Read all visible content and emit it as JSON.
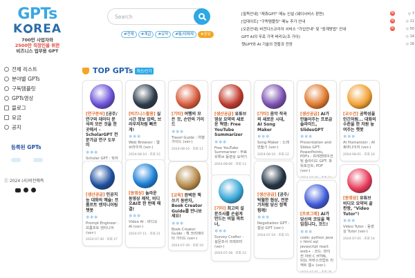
{
  "logo": {
    "line1": "GPTs",
    "line2_a": "K",
    "line2_b": "REA"
  },
  "tagline": {
    "line1": "700만 사업자와",
    "line2": "2500만 직장인을 위한",
    "line3": "비즈니스 업무용 GPT"
  },
  "nav": [
    {
      "label": "전체 리스트",
      "icon": "globe-icon"
    },
    {
      "label": "분야별 GPTs",
      "icon": "globe-icon"
    },
    {
      "label": "구독템플릿",
      "icon": "globe-icon"
    },
    {
      "label": "GPTs영상",
      "icon": "globe-icon"
    },
    {
      "label": "블로그",
      "icon": "doc-icon"
    },
    {
      "label": "요금",
      "icon": "doc-icon"
    },
    {
      "label": "공지",
      "icon": "globe-icon"
    }
  ],
  "side_heading": "등록된 GPTs",
  "copyright": "ⓒ 2024 (사)비전예측",
  "search": {
    "placeholder": "Search"
  },
  "tags": [
    {
      "label": "#전체",
      "accent": false
    },
    {
      "label": "#계급",
      "accent": false
    },
    {
      "label": "#요약",
      "accent": false
    },
    {
      "label": "#통/대체체",
      "accent": false
    },
    {
      "label": "#공유",
      "accent": true
    }
  ],
  "notices": [
    {
      "text": "[필독안내] \"제휴GPT\" 메뉴 신설 (웨이서비스 판면)",
      "badge": "N",
      "count": "7"
    },
    {
      "text": "[업데이트] \"구독템플릿\" 메뉴 추가 안내",
      "badge": "N",
      "count": "11"
    },
    {
      "text": "[오픈안내] 비전다스코리아 서비스 \"가입안내\" 및 \"중계방법\" 안내",
      "badge": "N",
      "count": "50"
    },
    {
      "text": "GPT AI의 무료 가격 버리오(조 가이)",
      "badge": "",
      "count": "14"
    },
    {
      "text": "챗GPT와 AI 기술의 현황과 전망",
      "badge": "",
      "count": "16"
    }
  ],
  "section": {
    "title": "TOP GPTs",
    "badge": "최신/인기"
  },
  "cards": [
    {
      "cat": "[연구분석]",
      "title": " [공주/ 연구와 데이터 분석의 모든 것을 한 곳에서 – ScholarGPT 전문가급 연구 도우미",
      "stars": "❄❄❄",
      "desc": "Scholar GPT : 학자 GPT (ver-)",
      "meta": "1월전 · 조회 7",
      "thumb_color": "#6a4fd8"
    },
    {
      "cat": "[비즈니스활용]",
      "title": " 실시간 정보 입력, 브라우저처럼 빠르게!",
      "stars": "❄❄❄",
      "desc": "Web Browser : 웹 브라우저 (ver-)",
      "meta": "2024-08-10 · 조회 15",
      "thumb_color": "#2b3a4a"
    },
    {
      "cat": "[기타]",
      "title": " 여행의 모든 것, 손안의 가이드",
      "stars": "❄❄❄",
      "desc": "Travel Guide : 여행 가이드 (ver-)",
      "meta": "2024-08-10 · 조회 11",
      "thumb_color": "#d85a3a"
    },
    {
      "cat": "[생산공급]",
      "title": " 유튜브 영상 요약의 새로운 혁명: Free YouTube Summarizer",
      "stars": "❄❄❄",
      "desc": "Free YouTube Summarizer : 무료 유튜브 동영상 요약기",
      "meta": "2024-08-06 · 조회 13",
      "thumb_color": "#c0392b"
    },
    {
      "cat": "[기타]",
      "title": " 음악 작곡의 새로운 시대, AI Song Maker",
      "stars": "❄❄❄",
      "desc": "Song Maker : 노래 만들기 (ver-)",
      "meta": "2024-08-10 · 조회 12",
      "thumb_color": "#7a4fb0"
    },
    {
      "cat": "[생산공급]",
      "title": " AI가 만들어주는 프로급 슬라이드, SlidesGPT",
      "stars": "❄❄❄",
      "desc": "Presentation and Slides GPT: PowerPoints, PDFs : 프레젠테이션 및 슬라이드 GPT: 파워포인트, PDF (ver-)",
      "meta": "2024-07-29 · 조회 11",
      "thumb_color": "#e0772a"
    },
    {
      "cat": "[교수건]",
      "title": " 공학성을 인간처럼... 대화의 수준을 한 차원 높여주는 챗봇",
      "stars": "❄❄❄",
      "desc": "AI Humanizer : AI 휴머나이저 (ver-)",
      "meta": "2024-08-01 · 조회 16",
      "thumb_color": "#f2a033"
    },
    {
      "cat": "[생산공급]",
      "title": " 인공지능 대화의 예술: 프롬프트 엔지니어링 챗봇",
      "stars": "❄❄❄",
      "desc": "Prompt Engineer : 프롬프트 엔지니어 (ver-)",
      "meta": "2024-07-30 · 조회 27",
      "thumb_color": "#1e4fa0"
    },
    {
      "cat": "[동영상]",
      "title": " 놀라운 동영상 제작, 비디오AI로 한 번에 해결!",
      "stars": "❄❄❄",
      "desc": "Video AI : 비디오 AI (ver-)",
      "meta": "2024-07-11 · 조회 21",
      "thumb_color": "#1a7fd6"
    },
    {
      "cat": "[교육]",
      "title": " 완벽한 책 쓰기 동반자, Book Creator Guide를 만나보세요!",
      "stars": "❄❄❄",
      "desc": "Book Creator Guide : 책 크리에이터 가이드 (ver-)",
      "meta": "2024-07-29 · 조회 19",
      "thumb_color": "#b58a4a"
    },
    {
      "cat": "[기타]",
      "title": " 최고의 설문조사를 손쉽게 만드는 비밀 파트너,",
      "stars": "❄❄❄",
      "desc": "Survey Crafter : 설문조사 크래프터 (ver-)",
      "meta": "2024-07-28 · 조회 23",
      "thumb_color": "#37a7d8"
    },
    {
      "cat": "[생산공급]",
      "title": " [공주/ 탁월한 협상, 전문가처럼 당신 정책 힘께!",
      "stars": "❄❄❄",
      "desc": "Negotiation GPT : 협상 GPT (ver-)",
      "meta": "2024-07-19 · 조회 15",
      "thumb_color": "#223344"
    },
    {
      "cat": "[프로그래]",
      "title": " AI가 당신의 코딩을 책임집니다, 코드!",
      "stars": "❄❄❄",
      "desc": "code: python java c html sql javascript react web+ : 코드: 파이썬 자바 C HTML SQL 자바스크립트 리액트 웹+ (ver-)",
      "meta": "2024-07-01 · 조회 25",
      "thumb_color": "#3d5ad8"
    },
    {
      "cat": "[동영상]",
      "title": " 유튜브 비디오 요약의 끝판왕, \"Video Tutor\"!",
      "stars": "❄❄❄",
      "desc": "Video Tutor : 동영상 Tutor (ver-)",
      "meta": "2024-07-01 · 조회 14",
      "thumb_color": "#e83a5a"
    }
  ]
}
